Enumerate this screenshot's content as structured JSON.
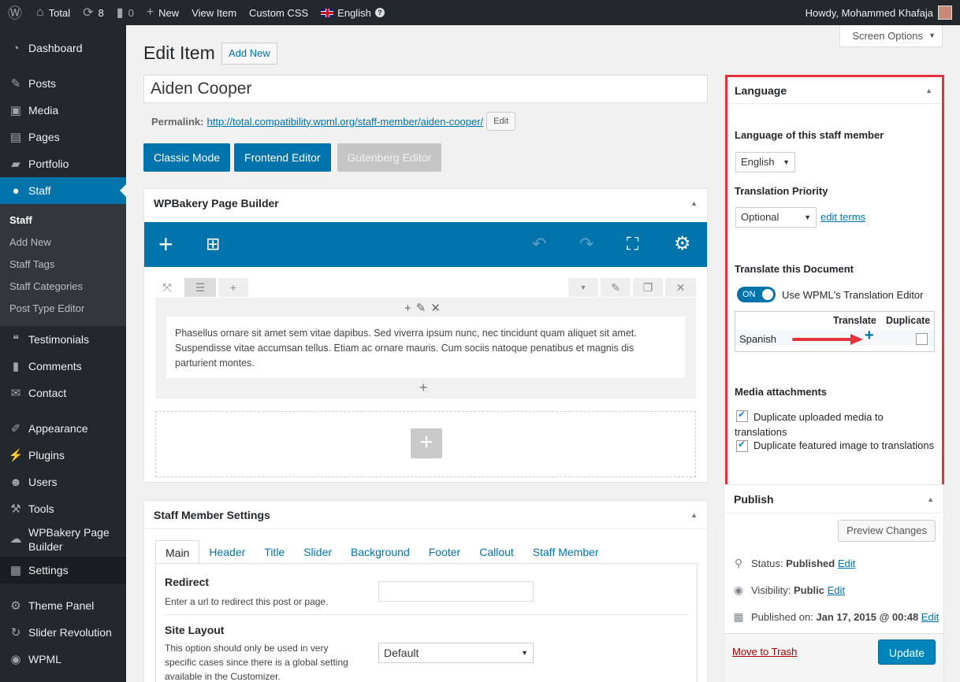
{
  "adminbar": {
    "site_name": "Total",
    "updates_count": "8",
    "comments_count": "0",
    "new_label": "New",
    "view_item": "View Item",
    "custom_css": "Custom CSS",
    "language": "English",
    "howdy": "Howdy, Mohammed Khafaja"
  },
  "sidebar": {
    "items": [
      {
        "label": "Dashboard",
        "icon": "dashboard-icon"
      },
      {
        "label": "Posts",
        "icon": "pin-icon"
      },
      {
        "label": "Media",
        "icon": "media-icon"
      },
      {
        "label": "Pages",
        "icon": "pages-icon"
      },
      {
        "label": "Portfolio",
        "icon": "portfolio-icon"
      },
      {
        "label": "Staff",
        "icon": "staff-icon"
      },
      {
        "label": "Testimonials",
        "icon": "testimonials-icon"
      },
      {
        "label": "Comments",
        "icon": "comments-icon"
      },
      {
        "label": "Contact",
        "icon": "envelope-icon"
      },
      {
        "label": "Appearance",
        "icon": "appearance-icon"
      },
      {
        "label": "Plugins",
        "icon": "plugins-icon"
      },
      {
        "label": "Users",
        "icon": "users-icon"
      },
      {
        "label": "Tools",
        "icon": "tools-icon"
      },
      {
        "label": "WPBakery Page Builder",
        "icon": "wpbakery-icon"
      },
      {
        "label": "Settings",
        "icon": "settings-icon"
      },
      {
        "label": "Theme Panel",
        "icon": "gear-icon"
      },
      {
        "label": "Slider Revolution",
        "icon": "refresh-icon"
      },
      {
        "label": "WPML",
        "icon": "globe-icon"
      }
    ],
    "staff_submenu": [
      "Staff",
      "Add New",
      "Staff Tags",
      "Staff Categories",
      "Post Type Editor"
    ]
  },
  "header": {
    "screen_options": "Screen Options",
    "page_title": "Edit Item",
    "add_new": "Add New"
  },
  "post": {
    "title": "Aiden Cooper",
    "permalink_label": "Permalink:",
    "permalink_base": "http://total.compatibility.wpml.org/staff-member/",
    "permalink_slug": "aiden-cooper",
    "permalink_end": "/",
    "edit_btn": "Edit"
  },
  "modes": {
    "classic": "Classic Mode",
    "frontend": "Frontend Editor",
    "gutenberg": "Gutenberg Editor"
  },
  "builder": {
    "title": "WPBakery Page Builder",
    "text": "Phasellus ornare sit amet sem vitae dapibus. Sed viverra ipsum nunc, nec tincidunt quam aliquet sit amet. Suspendisse vitae accumsan tellus. Etiam ac ornare mauris. Cum sociis natoque penatibus et magnis dis parturient montes."
  },
  "staff_settings": {
    "title": "Staff Member Settings",
    "tabs": [
      "Main",
      "Header",
      "Title",
      "Slider",
      "Background",
      "Footer",
      "Callout",
      "Staff Member"
    ],
    "redirect_label": "Redirect",
    "redirect_desc": "Enter a url to redirect this post or page.",
    "redirect_value": "",
    "layout_label": "Site Layout",
    "layout_desc": "This option should only be used in very specific cases since there is a global setting available in the Customizer.",
    "layout_value": "Default"
  },
  "language_box": {
    "title": "Language",
    "lang_label": "Language of this staff member",
    "lang_value": "English",
    "priority_label": "Translation Priority",
    "priority_value": "Optional",
    "edit_terms": "edit terms",
    "translate_doc_label": "Translate this Document",
    "toggle_text": "ON",
    "toggle_label": "Use WPML's Translation Editor",
    "col_translate": "Translate",
    "col_duplicate": "Duplicate",
    "row_language": "Spanish",
    "media_label": "Media attachments",
    "dup_media": "Duplicate uploaded media to translations",
    "dup_featured": "Duplicate featured image to translations"
  },
  "publish": {
    "title": "Publish",
    "preview": "Preview Changes",
    "status_label": "Status:",
    "status_value": "Published",
    "visibility_label": "Visibility:",
    "visibility_value": "Public",
    "published_label": "Published on:",
    "published_value": "Jan 17, 2015 @ 00:48",
    "edit": "Edit",
    "trash": "Move to Trash",
    "update": "Update"
  },
  "colors": {
    "accent": "#0073aa",
    "highlight_border": "#e5333c",
    "arrow": "#e5333c"
  }
}
